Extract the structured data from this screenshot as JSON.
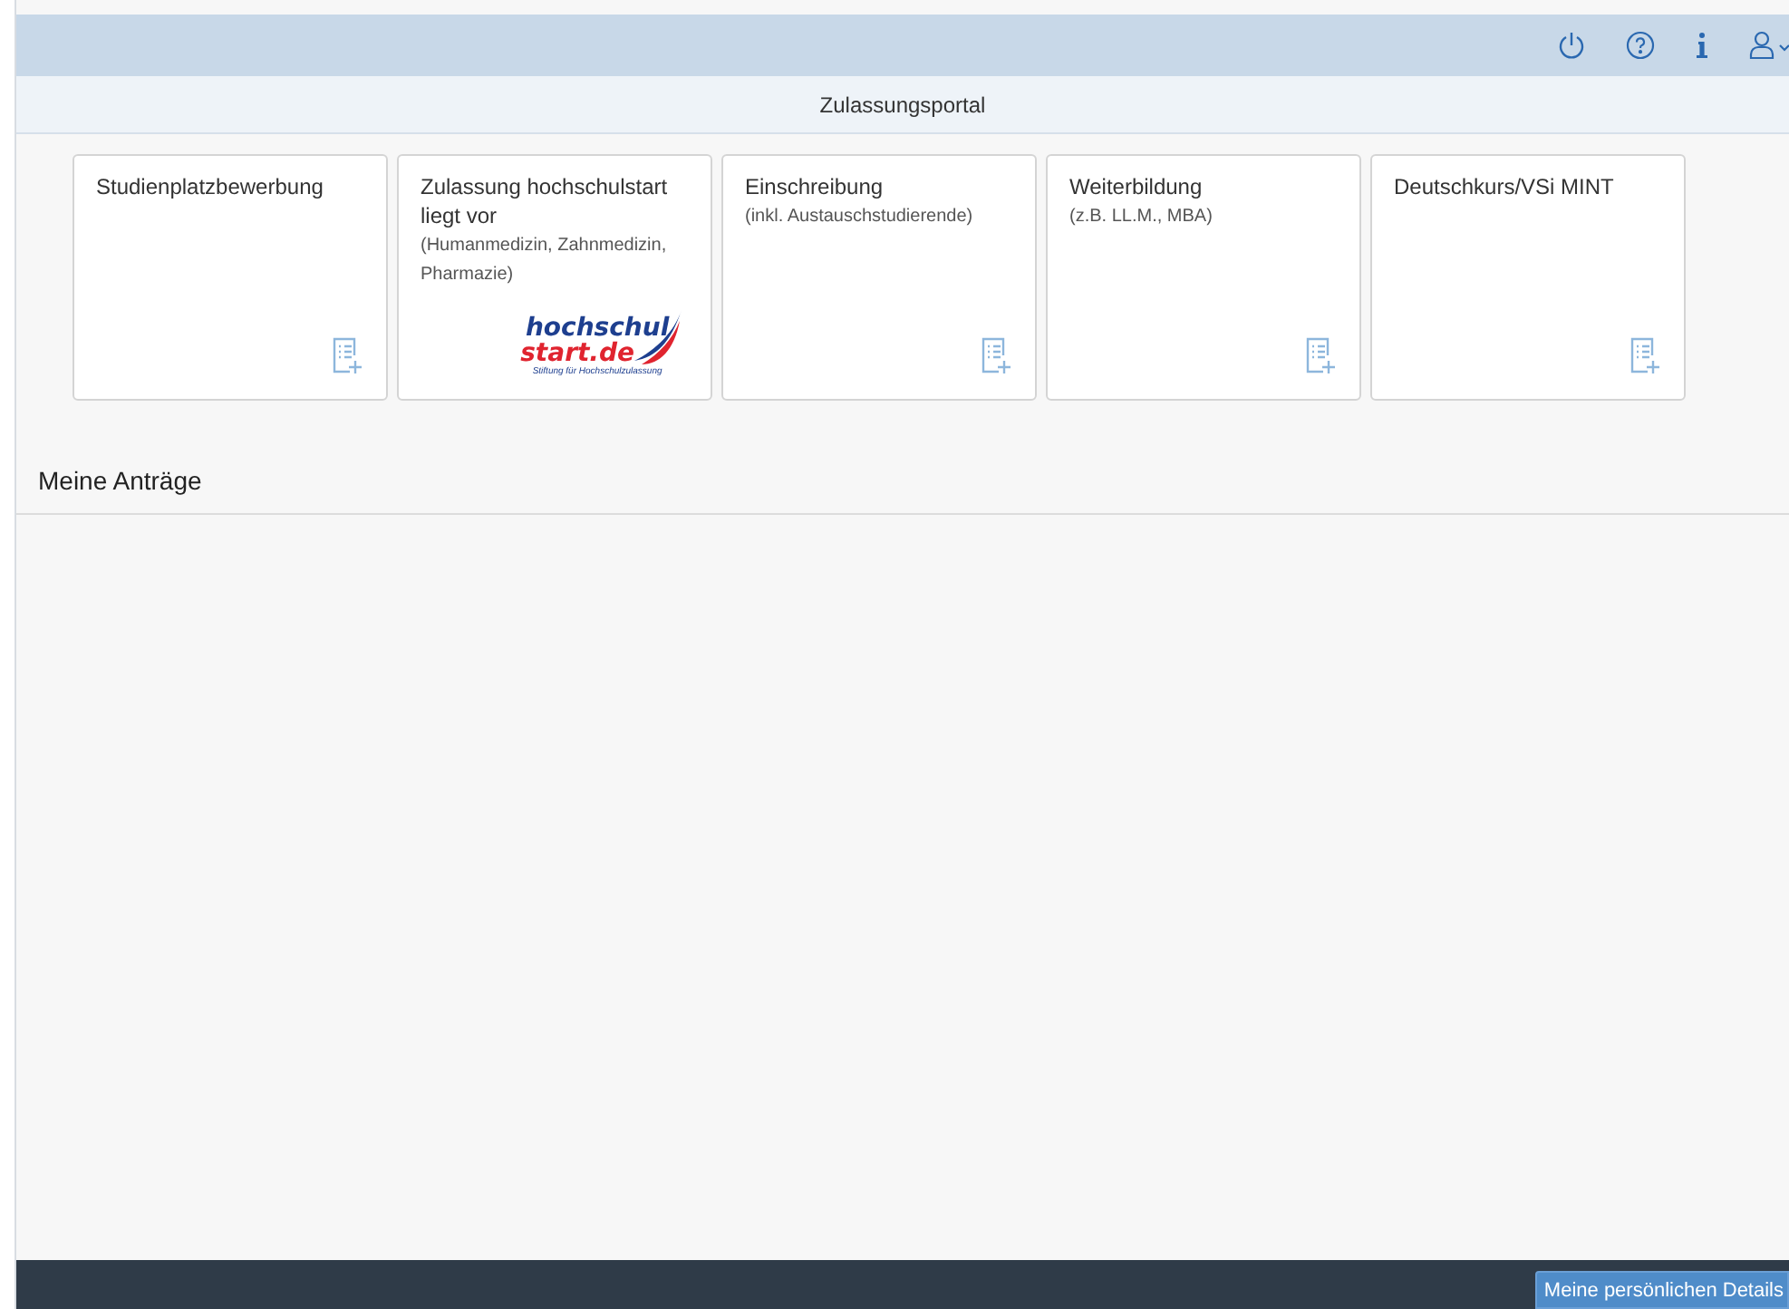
{
  "header": {
    "title": "Zulassungsportal"
  },
  "tiles": [
    {
      "kind": "icon",
      "title": "Studienplatzbewerbung"
    },
    {
      "kind": "logo",
      "title": "Zulassung hochschulstart liegt vor",
      "subtitle": "(Humanmedizin, Zahnmedizin, Pharmazie)",
      "logo": {
        "line_1": "hochschul",
        "line_2": "start.de",
        "tagline": "Stiftung für Hochschulzulassung"
      }
    },
    {
      "kind": "icon",
      "title": "Einschreibung",
      "subtitle": "(inkl. Austauschstudierende)"
    },
    {
      "kind": "icon",
      "title": "Weiterbildung",
      "subtitle": "(z.B. LL.M., MBA)"
    },
    {
      "kind": "icon",
      "title": "Deutschkurs/VSi MINT"
    }
  ],
  "section": {
    "title": "Meine Anträge"
  },
  "footer": {
    "button": "Meine persönlichen Details"
  }
}
